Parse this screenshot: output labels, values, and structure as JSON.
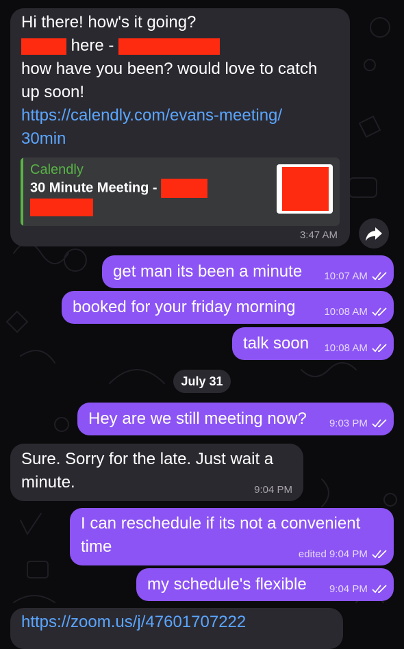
{
  "messages": [
    {
      "direction": "incoming",
      "lines": [
        "Hi there! how's it going?",
        "here -",
        "how have you been? would love to catch",
        "up soon!"
      ],
      "link_lines": [
        "https://calendly.com/evans-meeting/",
        "30min"
      ],
      "preview": {
        "site": "Calendly",
        "title": "30 Minute Meeting -"
      },
      "time": "3:47 AM"
    },
    {
      "direction": "outgoing",
      "text": "get man its been a minute",
      "time": "10:07 AM"
    },
    {
      "direction": "outgoing",
      "text": "booked for your friday morning",
      "time": "10:08 AM"
    },
    {
      "direction": "outgoing",
      "text": "talk soon",
      "time": "10:08 AM"
    },
    {
      "direction": "outgoing",
      "text": "Hey are we still meeting now?",
      "time": "9:03 PM"
    },
    {
      "direction": "incoming",
      "lines": [
        "Sure. Sorry for the late. Just wait a",
        "minute."
      ],
      "time": "9:04 PM"
    },
    {
      "direction": "outgoing",
      "lines": [
        "I can reschedule if its not a convenient",
        "time"
      ],
      "time": "edited 9:04 PM"
    },
    {
      "direction": "outgoing",
      "text": "my schedule's flexible",
      "time": "9:04 PM"
    },
    {
      "direction": "incoming",
      "link_partial": "https://zoom.us/j/47601707222"
    }
  ],
  "date_separator": "July 31",
  "icons": {
    "forward": "forward-arrow-icon",
    "read": "double-check-icon"
  },
  "colors": {
    "background": "#0b0b0d",
    "incoming_bubble": "#2b2930",
    "outgoing_bubble": "#8c54f4",
    "link": "#5aa6ff",
    "preview_accent": "#59b346",
    "redaction": "#ff2b10"
  }
}
